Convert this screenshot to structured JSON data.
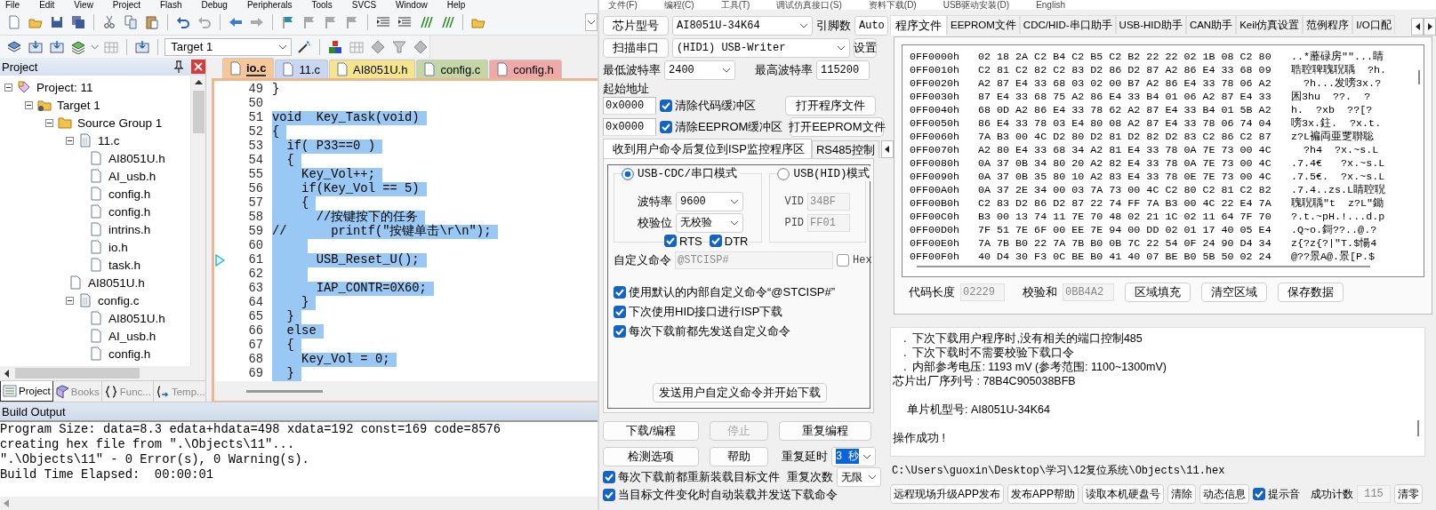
{
  "ide": {
    "menu": [
      "File",
      "Edit",
      "View",
      "Project",
      "Flash",
      "Debug",
      "Peripherals",
      "Tools",
      "SVCS",
      "Window",
      "Help"
    ],
    "target": "Target 1",
    "project_panel": {
      "title": "Project",
      "tree": [
        {
          "label": "Project: 11",
          "kind": "project",
          "expanded": true,
          "children": [
            {
              "label": "Target 1",
              "kind": "target",
              "expanded": true,
              "children": [
                {
                  "label": "Source Group 1",
                  "kind": "group",
                  "expanded": true,
                  "children": [
                    {
                      "label": "11.c",
                      "kind": "source",
                      "expanded": true,
                      "children": [
                        {
                          "label": "AI8051U.h",
                          "kind": "header"
                        },
                        {
                          "label": "AI_usb.h",
                          "kind": "header"
                        },
                        {
                          "label": "config.h",
                          "kind": "header"
                        },
                        {
                          "label": "config.h",
                          "kind": "header"
                        },
                        {
                          "label": "intrins.h",
                          "kind": "header"
                        },
                        {
                          "label": "io.h",
                          "kind": "header"
                        },
                        {
                          "label": "task.h",
                          "kind": "header"
                        }
                      ]
                    },
                    {
                      "label": "AI8051U.h",
                      "kind": "header"
                    },
                    {
                      "label": "config.c",
                      "kind": "source",
                      "expanded": true,
                      "children": [
                        {
                          "label": "AI8051U.h",
                          "kind": "header"
                        },
                        {
                          "label": "AI_usb.h",
                          "kind": "header"
                        },
                        {
                          "label": "config.h",
                          "kind": "header"
                        }
                      ]
                    }
                  ]
                }
              ]
            }
          ]
        }
      ],
      "tabs": [
        {
          "label": "Project",
          "kind": "project",
          "selected": true
        },
        {
          "label": "Books",
          "kind": "books",
          "selected": false
        },
        {
          "label": "Func...",
          "kind": "functions",
          "selected": false
        },
        {
          "label": "Temp...",
          "kind": "templates",
          "selected": false
        }
      ]
    },
    "editor": {
      "tabs": [
        {
          "label": "io.c",
          "color": "#f7c797",
          "selected": true
        },
        {
          "label": "11.c",
          "color": "#c9d7f2",
          "selected": false
        },
        {
          "label": "AI8051U.h",
          "color": "#f6e58f",
          "selected": false
        },
        {
          "label": "config.c",
          "color": "#c5d6a6",
          "selected": false
        },
        {
          "label": "config.h",
          "color": "#f0a9a9",
          "selected": false
        }
      ],
      "lines": [
        {
          "number": "49",
          "text": "}",
          "selected": false,
          "current": false
        },
        {
          "number": "50",
          "selected": false,
          "current": false
        },
        {
          "number": "51",
          "text": "void  Key_Task(void)",
          "selected": true,
          "current": false
        },
        {
          "number": "52",
          "text": "{",
          "selected": true,
          "current": false
        },
        {
          "number": "53",
          "text": "  if( P33==0 )",
          "selected": true,
          "current": false
        },
        {
          "number": "54",
          "text": "  {",
          "selected": true,
          "current": false
        },
        {
          "number": "55",
          "text": "    Key_Vol++;",
          "selected": true,
          "current": false
        },
        {
          "number": "56",
          "text": "    if(Key_Vol == 5)",
          "selected": true,
          "current": false
        },
        {
          "number": "57",
          "text": "    {",
          "selected": true,
          "current": false
        },
        {
          "number": "58",
          "text": "      //按键按下的任务",
          "selected": true,
          "current": false
        },
        {
          "number": "59",
          "text": "//      printf(\"按键单击\\r\\n\");",
          "selected": true,
          "current": false
        },
        {
          "number": "60",
          "selected": true,
          "current": false
        },
        {
          "number": "61",
          "text": "      USB_Reset_U();",
          "selected": true,
          "current": true
        },
        {
          "number": "62",
          "selected": true,
          "current": false
        },
        {
          "number": "63",
          "text": "      IAP_CONTR=0X60;",
          "selected": true,
          "current": false
        },
        {
          "number": "64",
          "text": "    }",
          "selected": true,
          "current": false
        },
        {
          "number": "65",
          "text": "  }",
          "selected": true,
          "current": false
        },
        {
          "number": "66",
          "text": "  else",
          "selected": true,
          "current": false
        },
        {
          "number": "67",
          "text": "  {",
          "selected": true,
          "current": false
        },
        {
          "number": "68",
          "text": "    Key_Vol = 0;",
          "selected": true,
          "current": false
        },
        {
          "number": "69",
          "text": "  }",
          "selected": true,
          "current": false
        }
      ]
    },
    "build_output": {
      "title": "Build Output",
      "lines": [
        "Program Size: data=8.3 edata+hdata=498 xdata=192 const=169 code=8576",
        "creating hex file from \".\\Objects\\11\"...",
        "\".\\Objects\\11\" - 0 Error(s), 0 Warning(s).",
        "Build Time Elapsed:  00:00:01"
      ]
    }
  },
  "isp": {
    "menu": [
      "文件(F)",
      "编程(C)",
      "工具(T)",
      "调试仿真接口(S)",
      "资料下载(D)",
      "USB驱动安装(D)",
      "English"
    ],
    "chip": {
      "button": "芯片型号",
      "value": "AI8051U-34K64",
      "pins_label": "引脚数",
      "pins_value": "Auto"
    },
    "port": {
      "button": "扫描串口",
      "value": "(HID1) USB-Writer",
      "settings_button": "设置"
    },
    "baud": {
      "min_label": "最低波特率",
      "min_value": "2400",
      "max_label": "最高波特率",
      "max_value": "115200"
    },
    "start_address": {
      "label": "起始地址",
      "rows": [
        {
          "value": "0x0000",
          "checkbox": "清除代码缓冲区",
          "checked": true,
          "button": "打开程序文件"
        },
        {
          "value": "0x0000",
          "checkbox": "清除EEPROM缓冲区",
          "checked": true,
          "button": "打开EEPROM文件"
        }
      ]
    },
    "option_tabs": [
      {
        "label": "收到用户命令后复位到ISP监控程序区",
        "selected": true
      },
      {
        "label": "RS485控制",
        "selected": false
      }
    ],
    "cdc_mode": {
      "label": "USB-CDC/串口模式",
      "selected": true,
      "baud_label": "波特率",
      "baud_value": "9600",
      "parity_label": "校验位",
      "parity_value": "无校验",
      "rts": {
        "label": "RTS",
        "checked": true
      },
      "dtr": {
        "label": "DTR",
        "checked": true
      }
    },
    "hid_mode": {
      "label": "USB(HID)模式",
      "selected": false,
      "vid_label": "VID",
      "vid_value": "34BF",
      "pid_label": "PID",
      "pid_value": "FF01"
    },
    "custom_command": {
      "label": "自定义命令",
      "value": "@STCISP#",
      "hex_label": "Hex",
      "hex_checked": false
    },
    "options": [
      {
        "label": "使用默认的内部自定义命令“@STCISP#”",
        "checked": true
      },
      {
        "label": "下次使用HID接口进行ISP下载",
        "checked": true
      },
      {
        "label": "每次下载前都先发送自定义命令",
        "checked": true
      }
    ],
    "send_button": "发送用户自定义命令并开始下载",
    "actions": [
      {
        "label": "下载/编程",
        "disabled": false
      },
      {
        "label": "停止",
        "disabled": true
      },
      {
        "label": "重复编程",
        "disabled": false
      },
      {
        "label": "检测选项",
        "disabled": false
      },
      {
        "label": "帮助",
        "disabled": false
      }
    ],
    "repeat_delay": {
      "label": "重复延时",
      "value": "3 秒"
    },
    "repeat_count": {
      "label": "重复次数",
      "value": "无限"
    },
    "reload_options": [
      {
        "label": "每次下载前都重新装载目标文件",
        "checked": true
      },
      {
        "label": "当目标文件变化时自动装载并发送下载命令",
        "checked": true
      }
    ],
    "file_tabs": [
      {
        "label": "程序文件",
        "selected": true
      },
      {
        "label": "EEPROM文件",
        "selected": false
      },
      {
        "label": "CDC/HID-串口助手",
        "selected": false
      },
      {
        "label": "USB-HID助手",
        "selected": false
      },
      {
        "label": "CAN助手",
        "selected": false
      },
      {
        "label": "Keil仿真设置",
        "selected": false
      },
      {
        "label": "范例程序",
        "selected": false
      },
      {
        "label": "I/O口配",
        "selected": false
      }
    ],
    "hex_rows": [
      {
        "address": "0FF0000h",
        "bytes": "02 18 2A C2 B4 C2 B5 C2 B2 22 22 02 1B 08 C2 80",
        "ascii": "..*蘼碌房\"\"...睛"
      },
      {
        "address": "0FF0010h",
        "bytes": "C2 81 C2 82 C2 83 D2 86 D2 87 A2 86 E4 33 68 09",
        "ascii": "聕聜聛聭聣聥  ?h."
      },
      {
        "address": "0FF0020h",
        "bytes": "A2 87 E4 33 68 03 02 00 B7 A2 86 E4 33 78 06 A2",
        "ascii": "  ?h...发嗙3x.?"
      },
      {
        "address": "0FF0030h",
        "bytes": "87 E4 33 68 75 A2 86 E4 33 B4 01 06 A2 87 E4 33",
        "ascii": "囷3hu  ??.  ?"
      },
      {
        "address": "0FF0040h",
        "bytes": "68 0D A2 86 E4 33 78 62 A2 87 E4 33 B4 01 5B A2",
        "ascii": "h.  ?xb  ??[?"
      },
      {
        "address": "0FF0050h",
        "bytes": "86 E4 33 78 03 E4 80 08 A2 87 E4 33 78 06 74 04",
        "ascii": "嗙3x.鉒.  ?x.t."
      },
      {
        "address": "0FF0060h",
        "bytes": "7A B3 00 4C D2 80 D2 81 D2 82 D2 83 C2 86 C2 87",
        "ascii": "z?L褊両亜覂聨聡"
      },
      {
        "address": "0FF0070h",
        "bytes": "A2 80 E4 33 68 34 A2 81 E4 33 78 0A 7E 73 00 4C",
        "ascii": "  ?h4  ?x.~s.L"
      },
      {
        "address": "0FF0080h",
        "bytes": "0A 37 0B 34 80 20 A2 82 E4 33 78 0A 7E 73 00 4C",
        "ascii": ".7.4€   ?x.~s.L"
      },
      {
        "address": "0FF0090h",
        "bytes": "0A 37 0B 35 80 10 A2 83 E4 33 78 0E 7E 73 00 4C",
        "ascii": ".7.5€.  ?x.~s.L"
      },
      {
        "address": "0FF00A0h",
        "bytes": "0A 37 2E 34 00 03 7A 73 00 4C C2 80 C2 81 C2 82",
        "ascii": ".7.4..zs.L睛聜聣"
      },
      {
        "address": "0FF00B0h",
        "bytes": "C2 83 D2 86 D2 87 22 74 FF 7A B3 00 4C 22 E4 7A",
        "ascii": "聭聣聥\"t  z?L\"鋤"
      },
      {
        "address": "0FF00C0h",
        "bytes": "B3 00 13 74 11 7E 70 48 02 21 1C 02 11 64 7F 70",
        "ascii": "?.t.~pH.!...d.p"
      },
      {
        "address": "0FF00D0h",
        "bytes": "7F 51 7E 6F 00 EE 7E 94 00 DD 02 01 17 40 05 E4",
        "ascii": ".Q~o.鎶??..@.?"
      },
      {
        "address": "0FF00E0h",
        "bytes": "7A 7B B0 22 7A 7B B0 0B 7C 22 54 0F 24 90 D4 34",
        "ascii": "z{?z{?|\"T.$愓4"
      },
      {
        "address": "0FF00F0h",
        "bytes": "40 D4 30 F3 0C BE B0 41 40 07 BE B0 5B 50 02 24",
        "ascii": "@??景A@.景[P.$"
      }
    ],
    "code_length_label": "代码长度",
    "code_length": "02229",
    "checksum_label": "校验和",
    "checksum": "0BB4A2",
    "hex_buttons": [
      "区域填充",
      "清空区域",
      "保存数据"
    ],
    "log": [
      {
        "text": ".  下次下载用户程序时,没有相关的端口控制485",
        "kind": "bullet",
        "spaced": false
      },
      {
        "text": ".  下次下载时不需要校验下载口令",
        "kind": "bullet",
        "spaced": false
      },
      {
        "text": ".  内部参考电压: 1193 mV (参考范围: 1100~1300mV)",
        "kind": "bullet",
        "spaced": false
      },
      {
        "text": "芯片出厂序列号 : 78B4C905038BFB",
        "kind": "plain",
        "spaced": false
      },
      {
        "text": "单片机型号: AI8051U-34K64",
        "kind": "indented",
        "spaced": true
      },
      {
        "text": "操作成功 !",
        "kind": "plain",
        "spaced": true
      }
    ],
    "path": "C:\\Users\\guoxin\\Desktop\\学习\\12复位系统\\Objects\\11.hex",
    "bottom_buttons": [
      "远程现场升级APP发布",
      "发布APP帮助",
      "读取本机硬盘号",
      "清除",
      "动态信息"
    ],
    "beep": {
      "label": "提示音",
      "checked": true
    },
    "success_label": "成功计数",
    "success_count": "115",
    "reset_button": "清零"
  }
}
